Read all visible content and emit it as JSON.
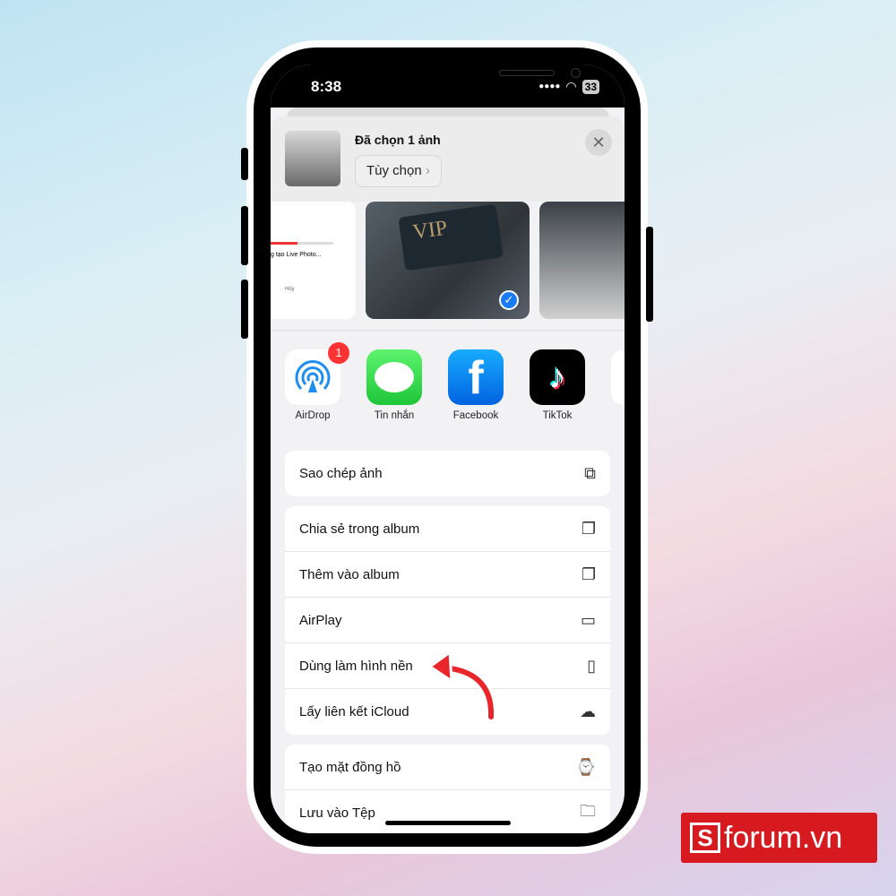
{
  "status": {
    "time": "8:38",
    "battery": "33"
  },
  "header": {
    "title": "Đã chọn 1 ảnh",
    "options_label": "Tùy chọn"
  },
  "preview": {
    "card_text": "VIP",
    "left_caption": "g tạo Live Photo...",
    "left_button": "Hủy"
  },
  "apps": [
    {
      "label": "AirDrop",
      "badge": "1"
    },
    {
      "label": "Tin nhắn"
    },
    {
      "label": "Facebook"
    },
    {
      "label": "TikTok"
    }
  ],
  "actions": {
    "group1": [
      {
        "label": "Sao chép ảnh",
        "icon": "copy-icon"
      }
    ],
    "group2": [
      {
        "label": "Chia sẻ trong album",
        "icon": "shared-album-icon"
      },
      {
        "label": "Thêm vào album",
        "icon": "add-album-icon"
      },
      {
        "label": "AirPlay",
        "icon": "airplay-icon"
      },
      {
        "label": "Dùng làm hình nền",
        "icon": "phone-icon"
      },
      {
        "label": "Lấy liên kết iCloud",
        "icon": "icloud-link-icon"
      }
    ],
    "group3": [
      {
        "label": "Tạo mặt đồng hồ",
        "icon": "watch-icon"
      },
      {
        "label": "Lưu vào Tệp",
        "icon": "folder-icon"
      }
    ]
  },
  "watermark": {
    "text": "forum.vn",
    "letter": "S"
  },
  "colors": {
    "accent": "#1a7cf5",
    "arrow": "#e8262b",
    "brand": "#d71920"
  }
}
